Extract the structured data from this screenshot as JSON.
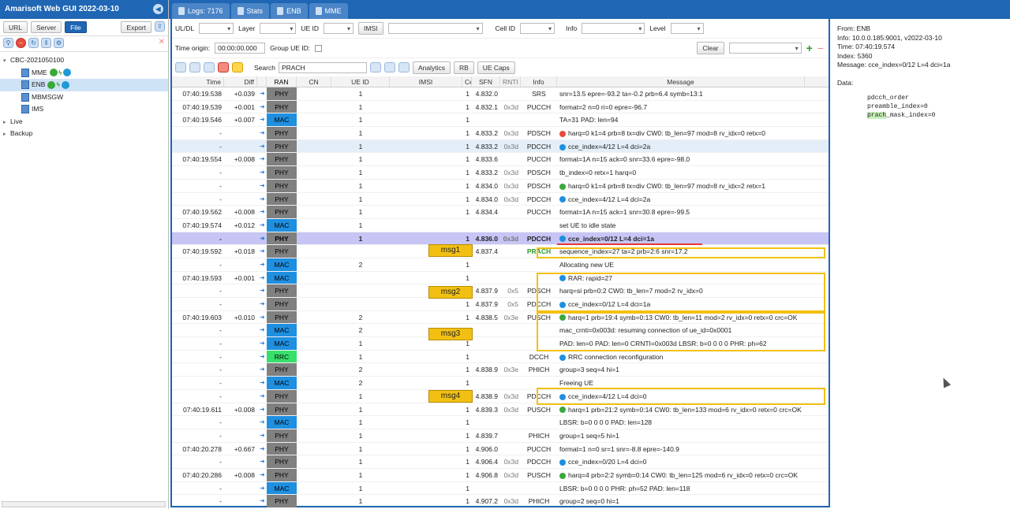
{
  "app": {
    "title": "Amarisoft Web GUI 2022-03-10"
  },
  "left_toolbar": {
    "url": "URL",
    "server": "Server",
    "file": "File",
    "export": "Export"
  },
  "tree": [
    {
      "label": "CBC-2021050100",
      "indent": 0,
      "toggle": "▾"
    },
    {
      "label": "MME",
      "indent": 1,
      "toggle": ""
    },
    {
      "label": "ENB",
      "indent": 1,
      "toggle": "",
      "selected": true
    },
    {
      "label": "MBMSGW",
      "indent": 1,
      "toggle": ""
    },
    {
      "label": "IMS",
      "indent": 1,
      "toggle": ""
    },
    {
      "label": "Live",
      "indent": 0,
      "toggle": "▸"
    },
    {
      "label": "Backup",
      "indent": 0,
      "toggle": "▸"
    }
  ],
  "tabs": [
    {
      "label": "Logs: 7176"
    },
    {
      "label": "Stats"
    },
    {
      "label": "ENB"
    },
    {
      "label": "MME"
    }
  ],
  "filters": {
    "uldl": "UL/DL",
    "layer": "Layer",
    "ueid": "UE ID",
    "imsi": "IMSI",
    "cellid": "Cell ID",
    "info": "Info",
    "level": "Level",
    "time_origin_label": "Time origin:",
    "time_origin_value": "00:00:00.000",
    "group_ue_label": "Group UE ID:",
    "clear": "Clear"
  },
  "toolbar": {
    "search_label": "Search",
    "search_value": "PRACH",
    "analytics": "Analytics",
    "rb": "RB",
    "uecaps": "UE Caps"
  },
  "columns": [
    "Time",
    "Diff",
    "RAN",
    "CN",
    "UE ID",
    "IMSI",
    "Cell",
    "SFN",
    "RNTI",
    "Info",
    "Message"
  ],
  "rows": [
    {
      "time": "07:40:19.538",
      "diff": "+0.039",
      "ran": "PHY",
      "ueid": "1",
      "cell": "1",
      "sfn": "4.832.0",
      "rnti": "",
      "info": "SRS",
      "msg": "snr=13.5 epre=-93.2 ta=-0.2 prb=6.4 symb=13:1",
      "icon": ""
    },
    {
      "time": "07:40:19.539",
      "diff": "+0.001",
      "ran": "PHY",
      "ueid": "1",
      "cell": "1",
      "sfn": "4.832.1",
      "rnti": "0x3d",
      "info": "PUCCH",
      "msg": "format=2 n=0 ri=0 epre=-96.7",
      "icon": ""
    },
    {
      "time": "07:40:19.546",
      "diff": "+0.007",
      "ran": "MAC",
      "ueid": "1",
      "cell": "1",
      "sfn": "",
      "rnti": "",
      "info": "",
      "msg": "TA=31 PAD: len=94",
      "icon": ""
    },
    {
      "time": "-",
      "diff": "",
      "ran": "PHY",
      "ueid": "1",
      "cell": "1",
      "sfn": "4.833.2",
      "rnti": "0x3d",
      "info": "PDSCH",
      "msg": "harq=0 k1=4 prb=8 tx=div CW0: tb_len=97 mod=8 rv_idx=0 retx=0",
      "icon": "r"
    },
    {
      "time": "-",
      "diff": "",
      "ran": "PHY",
      "ueid": "1",
      "cell": "1",
      "sfn": "4.833.2",
      "rnti": "0x3d",
      "info": "PDCCH",
      "msg": "cce_index=4/12 L=4 dci=2a",
      "icon": "i",
      "alt": true
    },
    {
      "time": "07:40:19.554",
      "diff": "+0.008",
      "ran": "PHY",
      "ueid": "1",
      "cell": "1",
      "sfn": "4.833.6",
      "rnti": "",
      "info": "PUCCH",
      "msg": "format=1A n=15 ack=0 snr=33.6 epre=-98.0",
      "icon": ""
    },
    {
      "time": "-",
      "diff": "",
      "ran": "PHY",
      "ueid": "1",
      "cell": "1",
      "sfn": "4.833.2",
      "rnti": "0x3d",
      "info": "PDSCH",
      "msg": "tb_index=0 retx=1 harq=0",
      "icon": ""
    },
    {
      "time": "-",
      "diff": "",
      "ran": "PHY",
      "ueid": "1",
      "cell": "1",
      "sfn": "4.834.0",
      "rnti": "0x3d",
      "info": "PDSCH",
      "msg": "harq=0 k1=4 prb=8 tx=div CW0: tb_len=97 mod=8 rv_idx=2 retx=1",
      "icon": "g"
    },
    {
      "time": "-",
      "diff": "",
      "ran": "PHY",
      "ueid": "1",
      "cell": "1",
      "sfn": "4.834.0",
      "rnti": "0x3d",
      "info": "PDCCH",
      "msg": "cce_index=4/12 L=4 dci=2a",
      "icon": "i"
    },
    {
      "time": "07:40:19.562",
      "diff": "+0.008",
      "ran": "PHY",
      "ueid": "1",
      "cell": "1",
      "sfn": "4.834.4",
      "rnti": "",
      "info": "PUCCH",
      "msg": "format=1A n=15 ack=1 snr=30.8 epre=-99.5",
      "icon": ""
    },
    {
      "time": "07:40:19.574",
      "diff": "+0.012",
      "ran": "MAC",
      "ueid": "1",
      "cell": "",
      "sfn": "",
      "rnti": "",
      "info": "",
      "msg": "set UE to idle state",
      "icon": ""
    },
    {
      "time": "-",
      "diff": "",
      "ran": "PHY",
      "ueid": "1",
      "cell": "1",
      "sfn": "4.836.0",
      "rnti": "0x3d",
      "info": "PDCCH",
      "msg": "cce_index=0/12 L=4 dci=1a",
      "icon": "i",
      "hl": true
    },
    {
      "time": "07:40:19.592",
      "diff": "+0.018",
      "ran": "PHY",
      "ueid": "",
      "cell": "1",
      "sfn": "4.837.4",
      "rnti": "",
      "info": "PRACH",
      "msg": "sequence_index=27 ta=2 prb=2:6 snr=17.2",
      "icon": "",
      "prach": true
    },
    {
      "time": "-",
      "diff": "",
      "ran": "MAC",
      "ueid": "2",
      "cell": "1",
      "sfn": "",
      "rnti": "",
      "info": "",
      "msg": "Allocating new UE",
      "icon": ""
    },
    {
      "time": "07:40:19.593",
      "diff": "+0.001",
      "ran": "MAC",
      "ueid": "",
      "cell": "1",
      "sfn": "",
      "rnti": "",
      "info": "",
      "msg": "RAR: rapid=27",
      "icon": "i"
    },
    {
      "time": "-",
      "diff": "",
      "ran": "PHY",
      "ueid": "",
      "cell": "1",
      "sfn": "4.837.9",
      "rnti": "0x5",
      "info": "PDSCH",
      "msg": "harq=si prb=0:2 CW0: tb_len=7 mod=2 rv_idx=0",
      "icon": ""
    },
    {
      "time": "-",
      "diff": "",
      "ran": "PHY",
      "ueid": "",
      "cell": "1",
      "sfn": "4.837.9",
      "rnti": "0x5",
      "info": "PDCCH",
      "msg": "cce_index=0/12 L=4 dci=1a",
      "icon": "i"
    },
    {
      "time": "07:40:19.603",
      "diff": "+0.010",
      "ran": "PHY",
      "ueid": "2",
      "cell": "1",
      "sfn": "4.838.5",
      "rnti": "0x3e",
      "info": "PUSCH",
      "msg": "harq=1 prb=19:4 symb=0:13 CW0: tb_len=11 mod=2 rv_idx=0 retx=0 crc=OK",
      "icon": "g"
    },
    {
      "time": "-",
      "diff": "",
      "ran": "MAC",
      "ueid": "2",
      "cell": "",
      "sfn": "",
      "rnti": "",
      "info": "",
      "msg": "mac_crnti=0x003d: resuming connection of ue_id=0x0001",
      "icon": ""
    },
    {
      "time": "-",
      "diff": "",
      "ran": "MAC",
      "ueid": "1",
      "cell": "1",
      "sfn": "",
      "rnti": "",
      "info": "",
      "msg": "PAD: len=0 PAD: len=0 CRNTI=0x003d LBSR: b=0 0 0 0 PHR: ph=62",
      "icon": ""
    },
    {
      "time": "-",
      "diff": "",
      "ran": "RRC",
      "ueid": "1",
      "cell": "1",
      "sfn": "",
      "rnti": "",
      "info": "DCCH",
      "msg": "RRC connection reconfiguration",
      "icon": "i"
    },
    {
      "time": "-",
      "diff": "",
      "ran": "PHY",
      "ueid": "2",
      "cell": "1",
      "sfn": "4.838.9",
      "rnti": "0x3e",
      "info": "PHICH",
      "msg": "group=3 seq=4 hi=1",
      "icon": ""
    },
    {
      "time": "-",
      "diff": "",
      "ran": "MAC",
      "ueid": "2",
      "cell": "1",
      "sfn": "",
      "rnti": "",
      "info": "",
      "msg": "Freeing UE",
      "icon": ""
    },
    {
      "time": "-",
      "diff": "",
      "ran": "PHY",
      "ueid": "1",
      "cell": "1",
      "sfn": "4.838.9",
      "rnti": "0x3d",
      "info": "PDCCH",
      "msg": "cce_index=4/12 L=4 dci=0",
      "icon": "i"
    },
    {
      "time": "07:40:19.611",
      "diff": "+0.008",
      "ran": "PHY",
      "ueid": "1",
      "cell": "1",
      "sfn": "4.839.3",
      "rnti": "0x3d",
      "info": "PUSCH",
      "msg": "harq=1 prb=21:2 symb=0:14 CW0: tb_len=133 mod=6 rv_idx=0 retx=0 crc=OK",
      "icon": "g"
    },
    {
      "time": "-",
      "diff": "",
      "ran": "MAC",
      "ueid": "1",
      "cell": "1",
      "sfn": "",
      "rnti": "",
      "info": "",
      "msg": "LBSR: b=0 0 0 0 PAD: len=128",
      "icon": ""
    },
    {
      "time": "-",
      "diff": "",
      "ran": "PHY",
      "ueid": "1",
      "cell": "1",
      "sfn": "4.839.7",
      "rnti": "",
      "info": "PHICH",
      "msg": "group=1 seq=5 hi=1",
      "icon": ""
    },
    {
      "time": "07:40:20.278",
      "diff": "+0.667",
      "ran": "PHY",
      "ueid": "1",
      "cell": "1",
      "sfn": "4.906.0",
      "rnti": "",
      "info": "PUCCH",
      "msg": "format=1 n=0 sr=1 snr=-8.8 epre=-140.9",
      "icon": ""
    },
    {
      "time": "-",
      "diff": "",
      "ran": "PHY",
      "ueid": "1",
      "cell": "1",
      "sfn": "4.906.4",
      "rnti": "0x3d",
      "info": "PDCCH",
      "msg": "cce_index=0/20 L=4 dci=0",
      "icon": "i"
    },
    {
      "time": "07:40:20.286",
      "diff": "+0.008",
      "ran": "PHY",
      "ueid": "1",
      "cell": "1",
      "sfn": "4.906.8",
      "rnti": "0x3d",
      "info": "PUSCH",
      "msg": "harq=4 prb=2:2 symb=0:14 CW0: tb_len=125 mod=6 rv_idx=0 retx=0 crc=OK",
      "icon": "g"
    },
    {
      "time": "-",
      "diff": "",
      "ran": "MAC",
      "ueid": "1",
      "cell": "1",
      "sfn": "",
      "rnti": "",
      "info": "",
      "msg": "LBSR: b=0 0 0 0 PHR: ph=52 PAD: len=118",
      "icon": ""
    },
    {
      "time": "-",
      "diff": "",
      "ran": "PHY",
      "ueid": "1",
      "cell": "1",
      "sfn": "4.907.2",
      "rnti": "0x3d",
      "info": "PHICH",
      "msg": "group=2 seq=0 hi=1",
      "icon": ""
    }
  ],
  "annotations": [
    "msg1",
    "msg2",
    "msg3",
    "msg4"
  ],
  "details": {
    "from": "From: ENB",
    "info": "Info: 10.0.0.185:9001, v2022-03-10",
    "time": "Time: 07:40:19.574",
    "index": "Index: 5360",
    "message": "Message: cce_index=0/12 L=4 dci=1a",
    "data_label": "Data:",
    "data_lines": [
      "pdcch_order",
      "preamble_index=0",
      "_mask_index=0"
    ],
    "prach_word": "prach"
  }
}
